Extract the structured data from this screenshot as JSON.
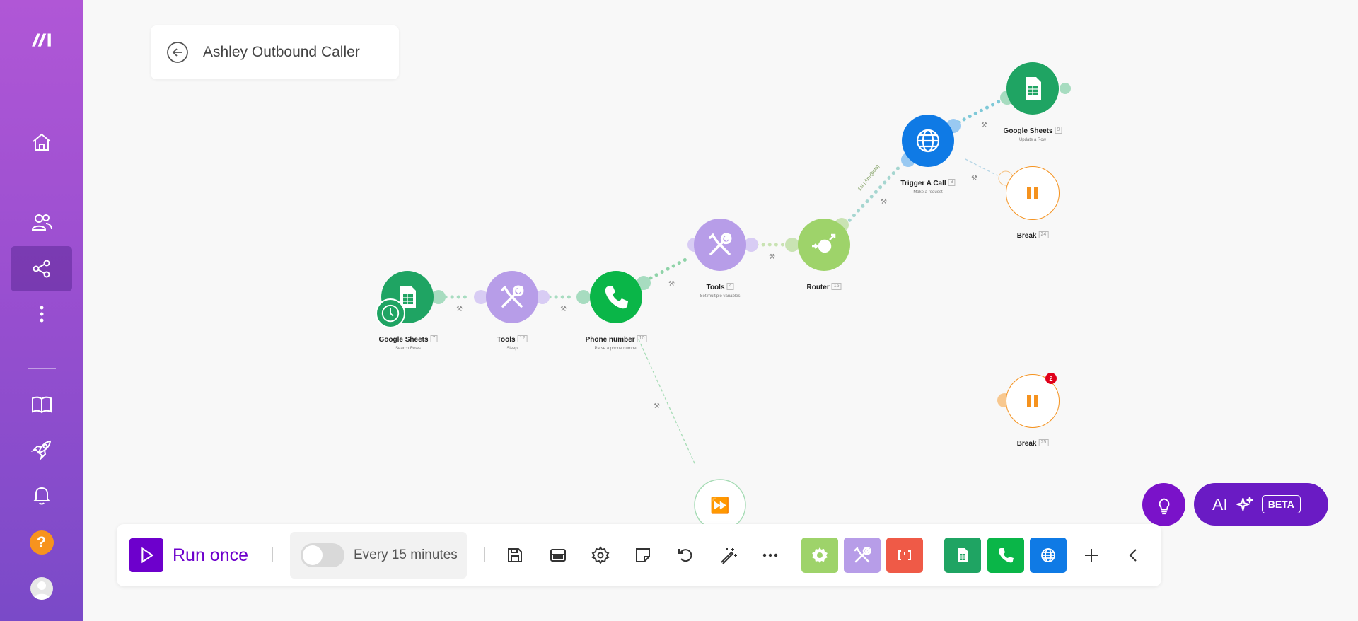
{
  "scenario": {
    "title": "Ashley Outbound Caller"
  },
  "nodes": [
    {
      "name": "Google Sheets",
      "id": "7",
      "subtitle": "Search Rows",
      "color": "#1fa463"
    },
    {
      "name": "Tools",
      "id": "12",
      "subtitle": "Sleep",
      "color": "#b79de8"
    },
    {
      "name": "Phone number",
      "id": "10",
      "subtitle": "Parse a phone number",
      "color": "#0ab648"
    },
    {
      "name": "Tools",
      "id": "4",
      "subtitle": "Set multiple variables",
      "color": "#b79de8"
    },
    {
      "name": "Router",
      "id": "15",
      "subtitle": "",
      "color": "#9ed36a"
    },
    {
      "name": "Trigger A Call",
      "id": "3",
      "subtitle": "Make a request",
      "color": "#0f7ae5"
    },
    {
      "name": "Google Sheets",
      "id": "9",
      "subtitle": "Update a Row",
      "color": "#1fa463"
    },
    {
      "name": "Break",
      "id": "24",
      "subtitle": "",
      "color": "#f5921e"
    },
    {
      "name": "Break",
      "id": "25",
      "subtitle": "",
      "color": "#f5921e",
      "badge": "2"
    }
  ],
  "route_filter_label": "1st | Ans(bets)",
  "toolbar": {
    "run_label": "Run once",
    "schedule_label": "Every 15 minutes",
    "schedule_on": false
  },
  "ai": {
    "label": "AI",
    "beta": "BETA"
  },
  "icons": {
    "sidebar": [
      "make-logo-icon",
      "home-icon",
      "team-icon",
      "share-icon",
      "more-icon",
      "book-icon",
      "rocket-icon",
      "bell-icon",
      "help-icon",
      "avatar"
    ],
    "toolbar": [
      "save-icon",
      "explain-flow-icon",
      "settings-icon",
      "notes-icon",
      "undo-icon",
      "magic-wand-icon",
      "more-icon"
    ]
  },
  "colors": {
    "brand": "#6d00cc",
    "sidebar_top": "#b057d6",
    "sidebar_bottom": "#7a4ac8"
  }
}
